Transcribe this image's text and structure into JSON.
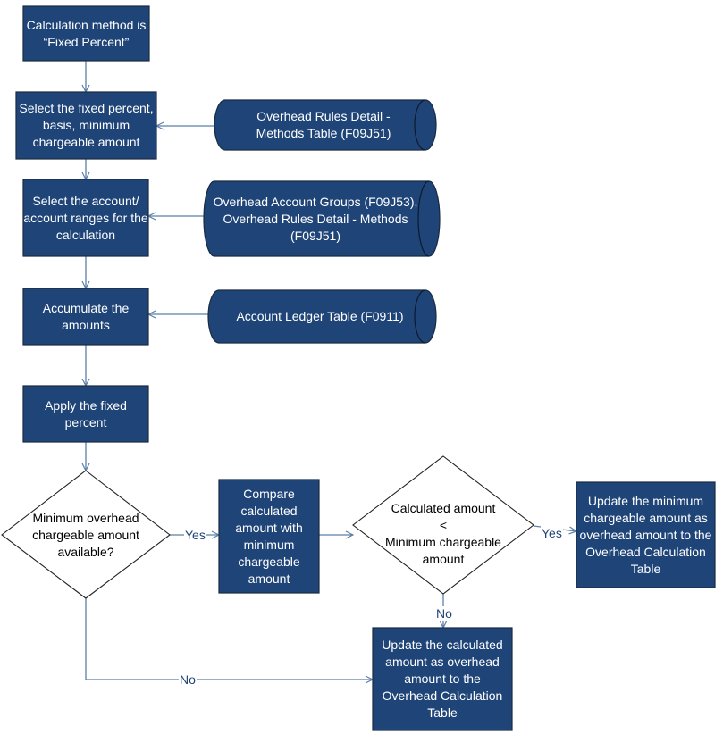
{
  "colors": {
    "box_fill": "#1f4478",
    "line": "#5b7fa8",
    "text_on_box": "#ffffff"
  },
  "process": {
    "start": "Calculation method is “Fixed Percent”",
    "select_percent": "Select the fixed percent, basis, minimum chargeable amount",
    "select_accounts": "Select the account/ account ranges for the calculation",
    "accumulate": "Accumulate the amounts",
    "apply": "Apply the fixed percent",
    "compare": "Compare calculated amount with minimum chargeable amount",
    "update_min": "Update the minimum chargeable amount as overhead amount to the Overhead Calculation Table",
    "update_calc": "Update the calculated amount as overhead amount to the Overhead Calculation Table"
  },
  "data_stores": {
    "rules_methods": "Overhead Rules Detail - Methods Table (F09J51)",
    "account_groups": "Overhead Account Groups (F09J53), Overhead Rules Detail - Methods (F09J51)",
    "ledger": "Account Ledger Table (F0911)"
  },
  "decisions": {
    "min_available": "Minimum overhead chargeable amount available?",
    "calc_less_line1": "Calculated amount",
    "calc_less_line2": "<",
    "calc_less_line3": "Minimum chargeable amount"
  },
  "edge_labels": {
    "yes1": "Yes",
    "yes2": "Yes",
    "no1": "No",
    "no2": "No"
  }
}
